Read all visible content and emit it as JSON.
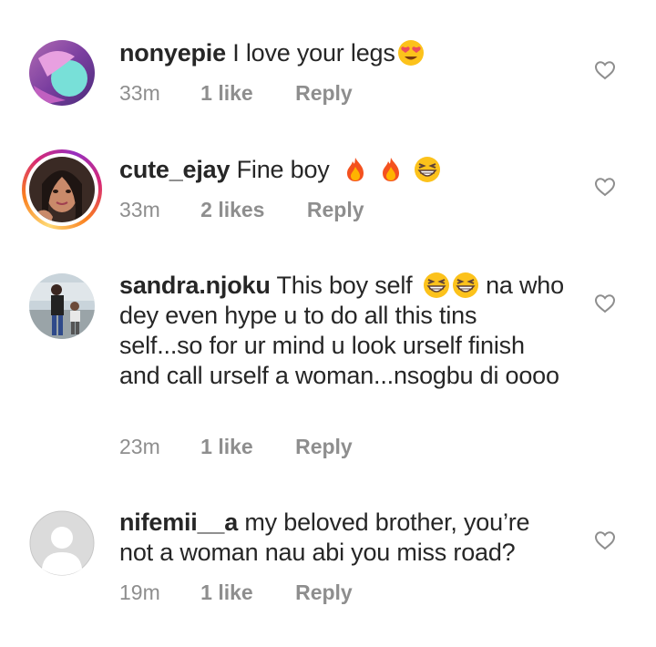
{
  "comments": [
    {
      "username": "nonyepie",
      "text": "I love your legs",
      "emojis": [
        "smiling-face-with-heart-eyes"
      ],
      "time": "33m",
      "likes": "1 like",
      "reply": "Reply"
    },
    {
      "username": "cute_ejay",
      "text": "Fine boy",
      "emojis": [
        "fire",
        "fire",
        "grinning-squinting-face"
      ],
      "time": "33m",
      "likes": "2 likes",
      "reply": "Reply"
    },
    {
      "username": "sandra.njoku",
      "text": "This boy self",
      "emojis": [
        "grinning-squinting-face",
        "grinning-squinting-face"
      ],
      "text_after": "na who dey even hype u to do all this tins self...so for ur mind u look urself finish and call urself a woman...nsogbu di oooo",
      "time": "23m",
      "likes": "1 like",
      "reply": "Reply"
    },
    {
      "username": "nifemii__a",
      "text": "my beloved brother, you’re not a woman nau abi you miss road?",
      "time": "19m",
      "likes": "1 like",
      "reply": "Reply"
    }
  ],
  "colors": {
    "text": "#262626",
    "meta": "#8e8e8e",
    "heart_outline": "#8e8e8e"
  },
  "icons": {
    "like": "heart-outline-icon"
  }
}
